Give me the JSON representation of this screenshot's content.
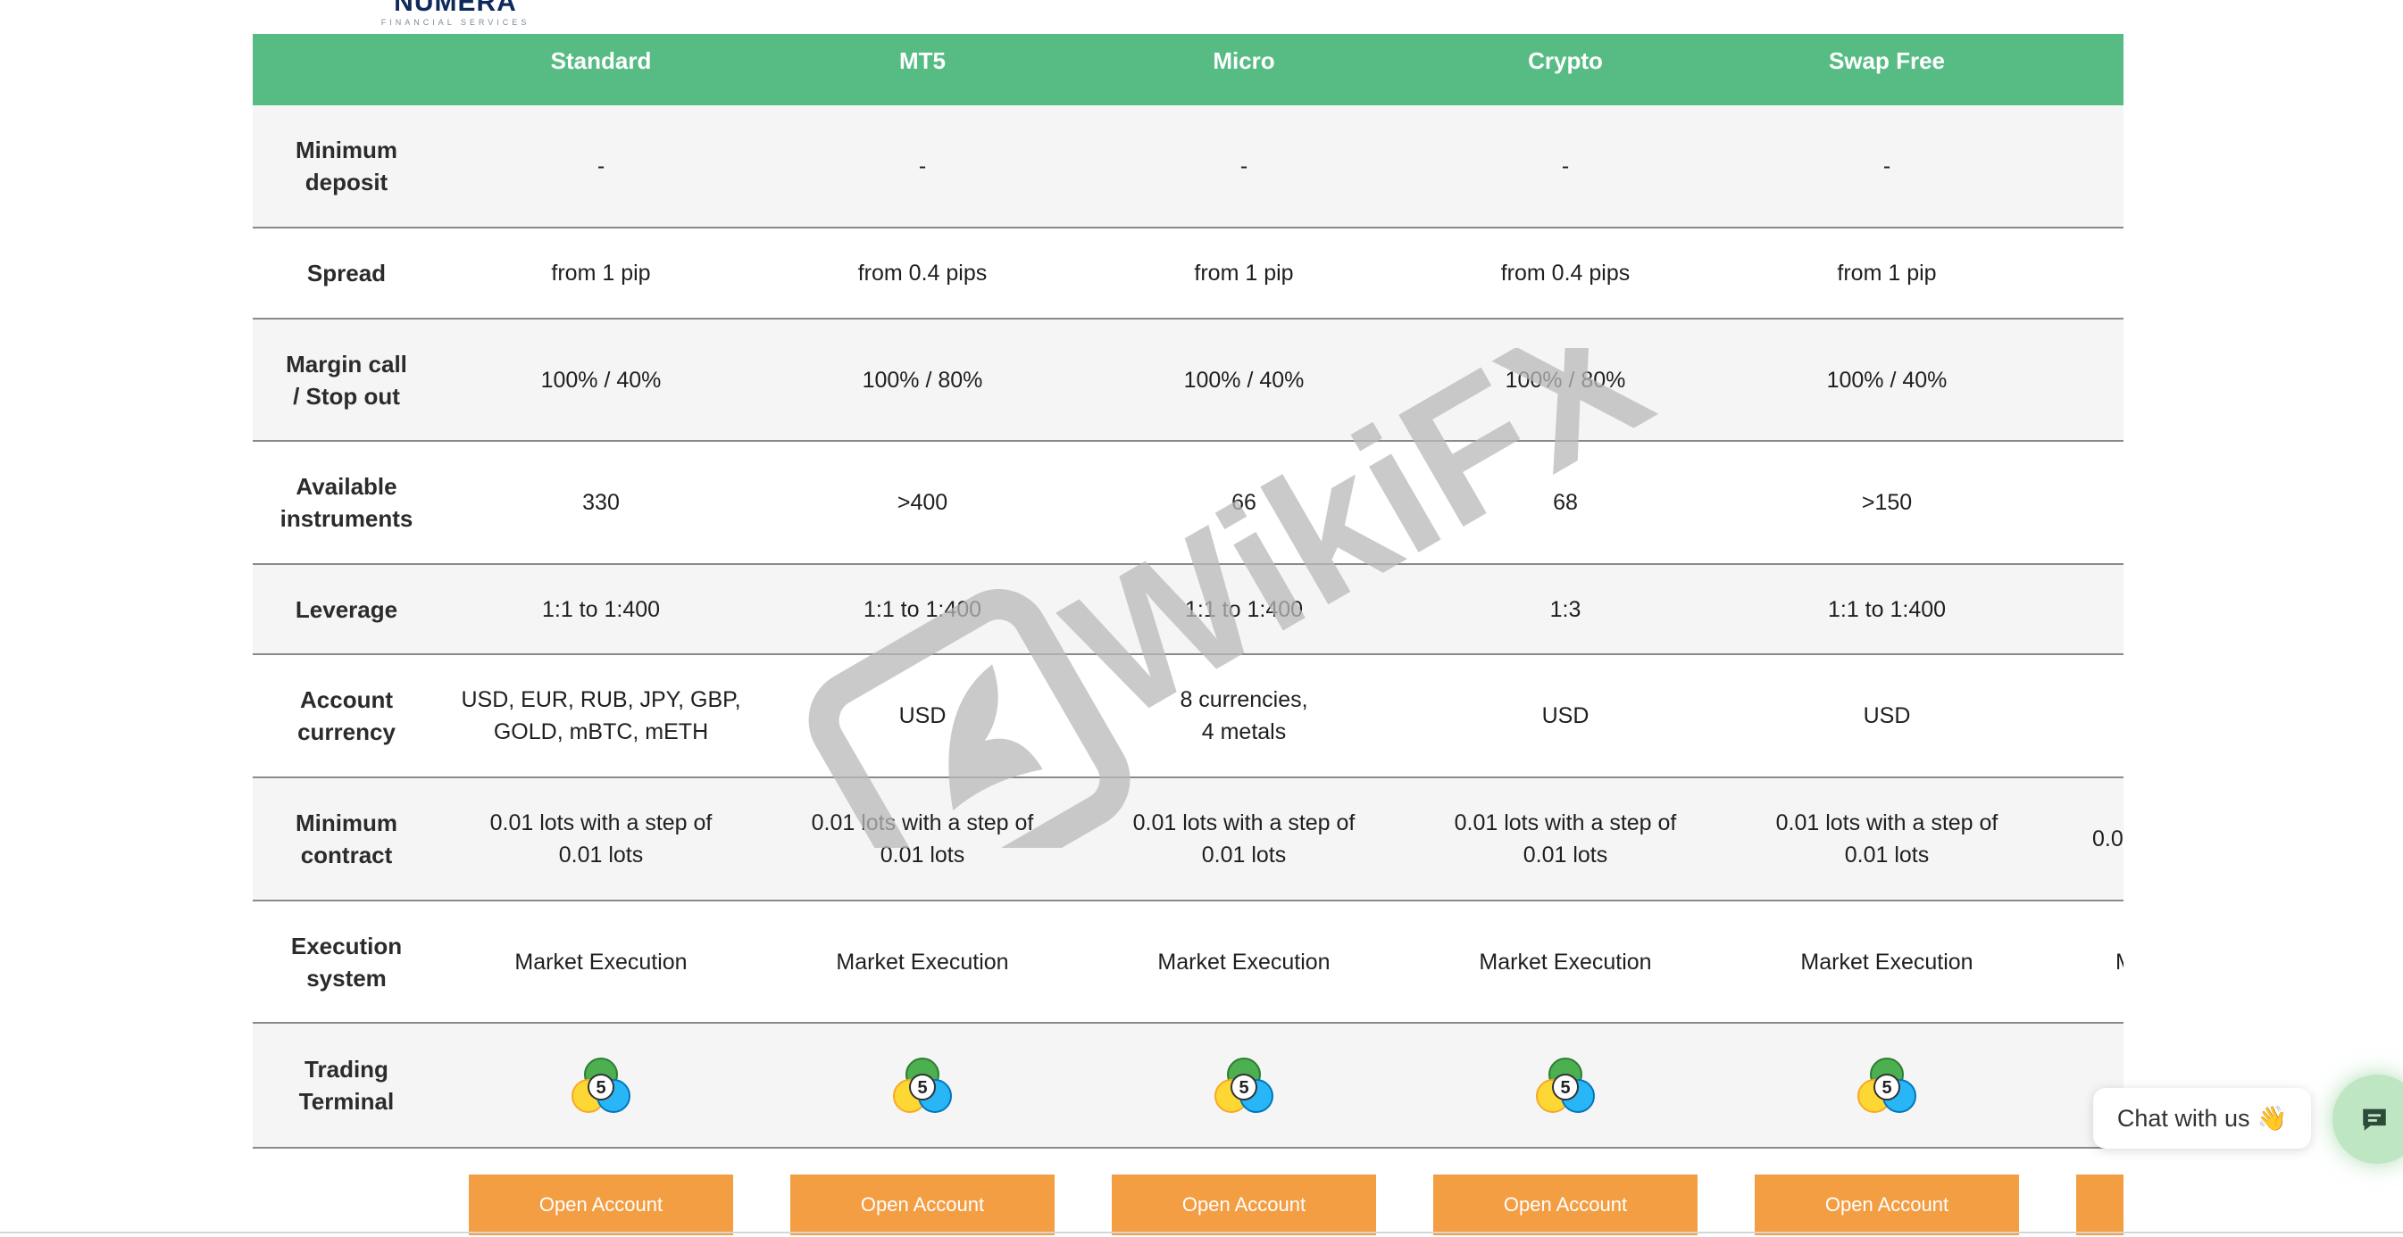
{
  "logo": {
    "text": "NUMERA",
    "subtitle": "FINANCIAL SERVICES"
  },
  "columns": [
    "Standard",
    "MT5",
    "Micro",
    "Crypto",
    "Swap Free"
  ],
  "rows": [
    {
      "label": "Minimum\ndeposit",
      "values": [
        "-",
        "-",
        "-",
        "-",
        "-"
      ],
      "overflow": ""
    },
    {
      "label": "Spread",
      "values": [
        "from 1 pip",
        "from 0.4 pips",
        "from 1 pip",
        "from 0.4 pips",
        "from 1 pip"
      ],
      "overflow": ""
    },
    {
      "label": "Margin call\n/ Stop out",
      "values": [
        "100% / 40%",
        "100% / 80%",
        "100% / 40%",
        "100% / 80%",
        "100% / 40%"
      ],
      "overflow": ""
    },
    {
      "label": "Available\ninstruments",
      "values": [
        "330",
        ">400",
        "66",
        "68",
        ">150"
      ],
      "overflow": ""
    },
    {
      "label": "Leverage",
      "values": [
        "1:1 to 1:400",
        "1:1 to 1:400",
        "1:1 to 1:400",
        "1:3",
        "1:1 to 1:400"
      ],
      "overflow": ""
    },
    {
      "label": "Account\ncurrency",
      "values": [
        "USD, EUR, RUB, JPY, GBP,\nGOLD, mBTC, mETH",
        "USD",
        "8 currencies,\n4 metals",
        "USD",
        "USD"
      ],
      "overflow": ""
    },
    {
      "label": "Minimum\ncontract",
      "values": [
        "0.01 lots with a step of\n0.01 lots",
        "0.01 lots with a step of\n0.01 lots",
        "0.01 lots with a step of\n0.01 lots",
        "0.01 lots with a step of\n0.01 lots",
        "0.01 lots with a step of\n0.01 lots"
      ],
      "overflow": "0.0"
    },
    {
      "label": "Execution\nsystem",
      "values": [
        "Market Execution",
        "Market Execution",
        "Market Execution",
        "Market Execution",
        "Market Execution"
      ],
      "overflow": "M"
    },
    {
      "label": "Trading\nTerminal",
      "values": [
        "",
        "",
        "",
        "",
        ""
      ],
      "overflow": ""
    }
  ],
  "terminal_icon": {
    "name": "metatrader5-icon",
    "badge": "5"
  },
  "open_account_label": "Open Account",
  "watermark": {
    "text": "WikiFX"
  },
  "chat": {
    "label": "Chat with us",
    "emoji": "👋"
  },
  "colors": {
    "header": "#57bc84",
    "button": "#f39e43",
    "row_alt": "#f5f5f5",
    "logo": "#0e2a5c"
  }
}
